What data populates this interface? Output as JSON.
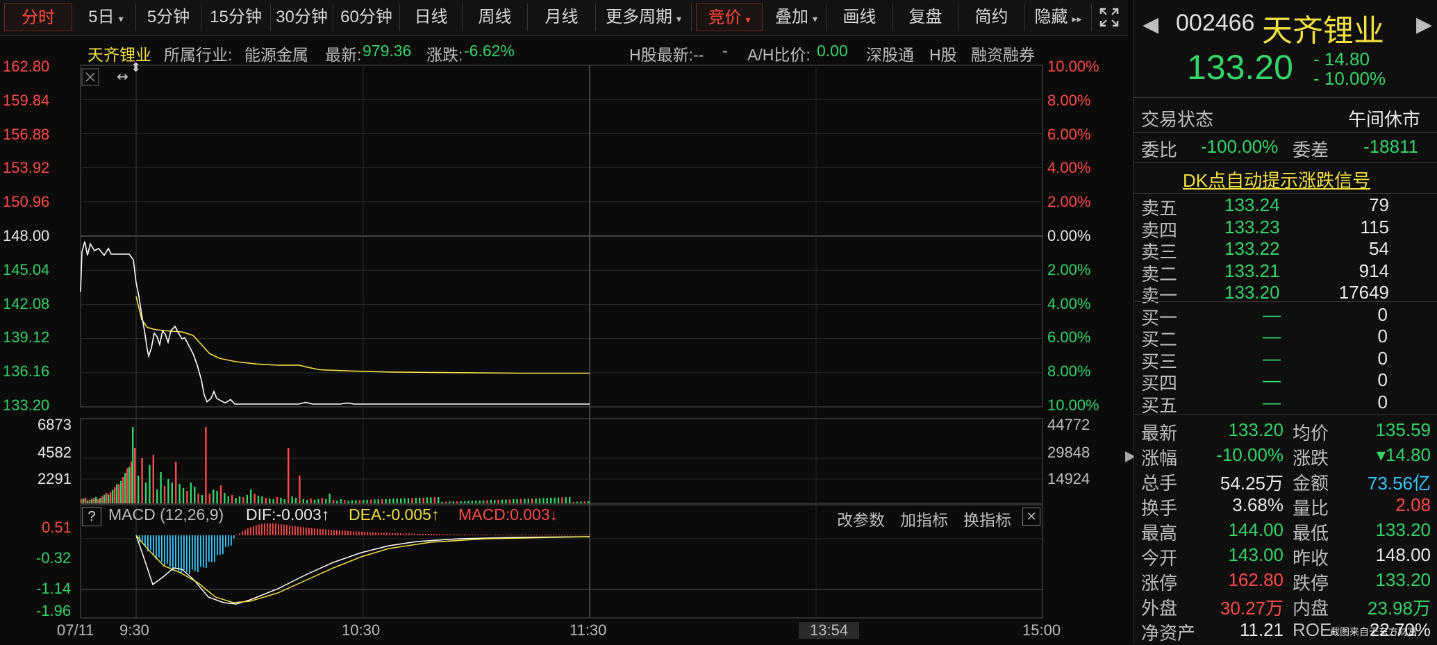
{
  "toolbar": {
    "tabs": [
      "分时",
      "5日",
      "5分钟",
      "15分钟",
      "30分钟",
      "60分钟",
      "日线",
      "周线",
      "月线",
      "更多周期",
      "竞价",
      "叠加",
      "画线",
      "复盘",
      "简约",
      "隐藏"
    ]
  },
  "info": {
    "name": "天齐锂业",
    "industry_label": "所属行业:",
    "industry": "能源金属",
    "latest_label": "最新:",
    "latest": "979.36",
    "change_label": "涨跌:",
    "change": "-6.62%",
    "hshare_label": "H股最新:--",
    "hshare_value": "-",
    "ah_label": "A/H比价:",
    "ah_value": "0.00",
    "sgt": "深股通",
    "hs": "H股",
    "margin": "融资融券"
  },
  "price_axis": [
    "162.80",
    "159.84",
    "156.88",
    "153.92",
    "150.96",
    "148.00",
    "145.04",
    "142.08",
    "139.12",
    "136.16",
    "133.20"
  ],
  "pct_axis": [
    "10.00%",
    "8.00%",
    "6.00%",
    "4.00%",
    "2.00%",
    "0.00%",
    "2.00%",
    "4.00%",
    "6.00%",
    "8.00%",
    "10.00%"
  ],
  "volume_axis_left": [
    "6873",
    "4582",
    "2291"
  ],
  "volume_axis_right": [
    "44772",
    "29848",
    "14924"
  ],
  "macd": {
    "title": "MACD (12,26,9)",
    "help": "?",
    "dif": "DIF:-0.003↑",
    "dea": "DEA:-0.005↑",
    "macd": "MACD:0.003↓",
    "btn_params": "改参数",
    "btn_add": "加指标",
    "btn_swap": "换指标",
    "axis": [
      "0.51",
      "-0.32",
      "-1.14",
      "-1.96"
    ]
  },
  "time_axis": [
    "07/11",
    "9:30",
    "10:30",
    "11:30",
    "13:54",
    "15:00"
  ],
  "panel": {
    "code": "002466",
    "name": "天齐锂业",
    "price": "133.20",
    "change": "- 14.80",
    "change_pct": "- 10.00%",
    "status_label": "交易状态",
    "status_value": "午间休市",
    "weibi_label": "委比",
    "weibi": "-100.00%",
    "weicha_label": "委差",
    "weicha": "-18811",
    "dk_link": "DK点自动提示涨跌信号",
    "asks": [
      {
        "label": "卖五",
        "price": "133.24",
        "vol": "79"
      },
      {
        "label": "卖四",
        "price": "133.23",
        "vol": "115"
      },
      {
        "label": "卖三",
        "price": "133.22",
        "vol": "54"
      },
      {
        "label": "卖二",
        "price": "133.21",
        "vol": "914"
      },
      {
        "label": "卖一",
        "price": "133.20",
        "vol": "17649"
      }
    ],
    "bids": [
      {
        "label": "买一",
        "price": "—",
        "vol": "0"
      },
      {
        "label": "买二",
        "price": "—",
        "vol": "0"
      },
      {
        "label": "买三",
        "price": "—",
        "vol": "0"
      },
      {
        "label": "买四",
        "price": "—",
        "vol": "0"
      },
      {
        "label": "买五",
        "price": "—",
        "vol": "0"
      }
    ],
    "stats": [
      {
        "l1": "最新",
        "v1": "133.20",
        "c1": "green",
        "l2": "均价",
        "v2": "135.59",
        "c2": "green"
      },
      {
        "l1": "涨幅",
        "v1": "-10.00%",
        "c1": "green",
        "l2": "涨跌",
        "v2": "▾14.80",
        "c2": "green"
      },
      {
        "l1": "总手",
        "v1": "54.25万",
        "c1": "white",
        "l2": "金额",
        "v2": "73.56亿",
        "c2": "cyan"
      },
      {
        "l1": "换手",
        "v1": "3.68%",
        "c1": "white",
        "l2": "量比",
        "v2": "2.08",
        "c2": "red"
      },
      {
        "l1": "最高",
        "v1": "144.00",
        "c1": "green",
        "l2": "最低",
        "v2": "133.20",
        "c2": "green"
      },
      {
        "l1": "今开",
        "v1": "143.00",
        "c1": "green",
        "l2": "昨收",
        "v2": "148.00",
        "c2": "white"
      },
      {
        "l1": "涨停",
        "v1": "162.80",
        "c1": "red",
        "l2": "跌停",
        "v2": "133.20",
        "c2": "green"
      },
      {
        "l1": "外盘",
        "v1": "30.27万",
        "c1": "red",
        "l2": "内盘",
        "v2": "23.98万",
        "c2": "green"
      },
      {
        "l1": "净资产",
        "v1": "11.21",
        "c1": "white",
        "l2": "ROE",
        "v2": "22.70%",
        "c2": "white"
      }
    ],
    "watermark": "截图来自于东方财富"
  },
  "colors": {
    "up": "#ff4a4a",
    "down": "#34d46a",
    "price_line": "#ffffff",
    "avg_line": "#f0e040",
    "macd_dea": "#f0e040",
    "bg": "#0b0b0b"
  }
}
